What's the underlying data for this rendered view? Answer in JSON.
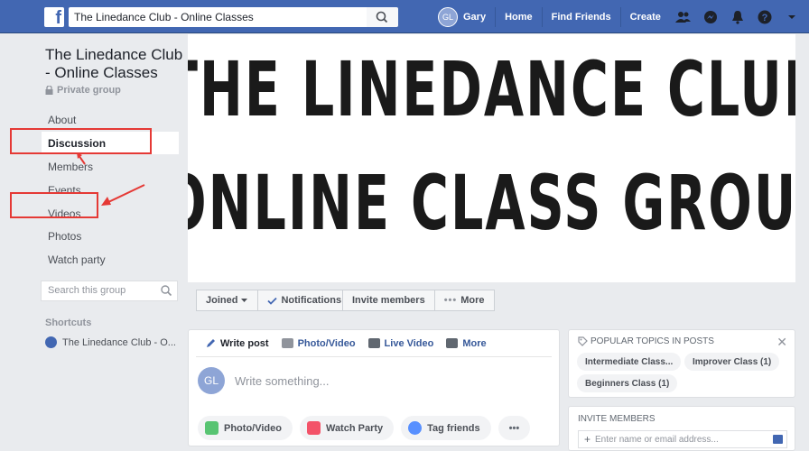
{
  "topbar": {
    "search_value": "The Linedance Club - Online Classes",
    "user_initials": "GL",
    "user_name": "Gary",
    "home": "Home",
    "find_friends": "Find Friends",
    "create": "Create",
    "brand_color": "#4267b2"
  },
  "group": {
    "title": "The Linedance Club - Online Classes",
    "privacy": "Private group"
  },
  "nav": {
    "about": "About",
    "discussion": "Discussion",
    "members": "Members",
    "events": "Events",
    "videos": "Videos",
    "photos": "Photos",
    "watch_party": "Watch party"
  },
  "sidebar": {
    "search_placeholder": "Search this group",
    "shortcuts_label": "Shortcuts",
    "shortcut_item": "The Linedance Club - O..."
  },
  "cover": {
    "line1": "THE LINEDANCE CLUB",
    "line2": "ONLINE CLASS GROUP"
  },
  "cover_actions": {
    "joined": "Joined",
    "notifications": "Notifications",
    "invite_members": "Invite members",
    "more": "More"
  },
  "composer": {
    "write_post": "Write post",
    "photo_video": "Photo/Video",
    "live_video": "Live Video",
    "more": "More",
    "avatar_initials": "GL",
    "placeholder": "Write something...",
    "btn_photo_video": "Photo/Video",
    "btn_watch_party": "Watch Party",
    "btn_tag_friends": "Tag friends",
    "btn_more": "•••"
  },
  "topics": {
    "title": "POPULAR TOPICS IN POSTS",
    "chips": [
      "Intermediate Class...",
      "Improver Class (1)",
      "Beginners Class (1)"
    ]
  },
  "invite": {
    "title": "INVITE MEMBERS",
    "placeholder": "Enter name or email address..."
  },
  "annotation_color": "#e53935"
}
